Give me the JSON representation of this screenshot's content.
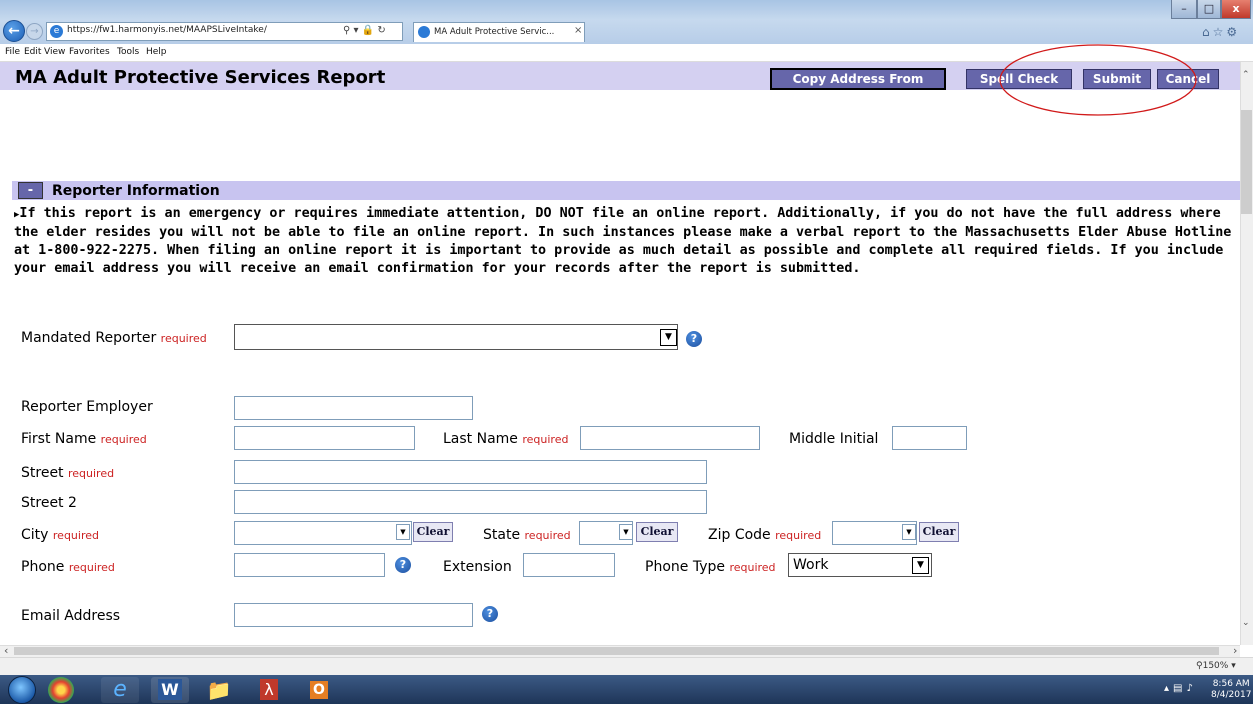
{
  "browser": {
    "url": "https://fw1.harmonyis.net/MAAPSLiveIntake/",
    "tab_title": "MA Adult Protective Servic...",
    "tab_close": "×",
    "menu": [
      "File",
      "Edit",
      "View",
      "Favorites",
      "Tools",
      "Help"
    ],
    "zoom": "150%",
    "window_controls": {
      "minimize": "–",
      "maximize": "□",
      "close": "x"
    }
  },
  "page": {
    "title": "MA Adult Protective Services Report",
    "toolbar": {
      "copy_address": "Copy Address From",
      "spell_check": "Spell Check",
      "submit": "Submit",
      "cancel": "Cancel"
    }
  },
  "section": {
    "toggle": "-",
    "title": "Reporter Information",
    "notice": "If this report is an emergency or requires immediate attention, DO NOT file an online report. Additionally, if you do not have the full address where the elder resides you will not be able to file an online report. In such instances please make a verbal report to the Massachusetts Elder Abuse Hotline at 1-800-922-2275. When filing an online report it is important to provide as much detail as possible and complete all required fields. If you include your email address you will receive an email confirmation for your records after the report is submitted."
  },
  "form": {
    "required": "required",
    "clear": "Clear",
    "mandated_reporter": {
      "label": "Mandated Reporter",
      "value": ""
    },
    "reporter_employer": {
      "label": "Reporter Employer",
      "value": ""
    },
    "first_name": {
      "label": "First Name",
      "value": ""
    },
    "last_name": {
      "label": "Last Name",
      "value": ""
    },
    "middle_initial": {
      "label": "Middle Initial",
      "value": ""
    },
    "street": {
      "label": "Street",
      "value": ""
    },
    "street2": {
      "label": "Street 2",
      "value": ""
    },
    "city": {
      "label": "City",
      "value": ""
    },
    "state": {
      "label": "State",
      "value": ""
    },
    "zip": {
      "label": "Zip Code",
      "value": ""
    },
    "phone": {
      "label": "Phone",
      "value": ""
    },
    "extension": {
      "label": "Extension",
      "value": ""
    },
    "phone_type": {
      "label": "Phone Type",
      "value": "Work"
    },
    "email": {
      "label": "Email Address",
      "value": ""
    }
  },
  "taskbar": {
    "time": "8:56 AM",
    "date": "8/4/2017"
  },
  "colors": {
    "header_bg": "#d4d0f1",
    "button_bg": "#6666aa",
    "required_text": "#cc2222",
    "annotation_circle": "#d11a1a"
  }
}
